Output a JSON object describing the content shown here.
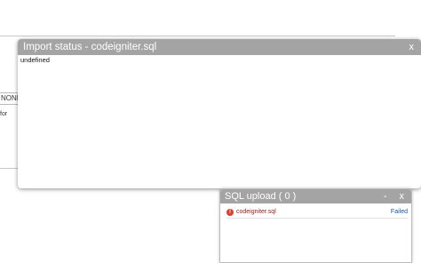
{
  "background": {
    "select_value": "NONE",
    "hint_fragment": "for"
  },
  "import_dialog": {
    "title": "Import status - codeigniter.sql",
    "close_label": "x",
    "body_text": "undefined"
  },
  "upload_panel": {
    "title": "SQL upload ( 0 )",
    "minimize_label": "-",
    "close_label": "x",
    "files": [
      {
        "name": "codeigniter.sql",
        "status": "Failed",
        "icon": "error-icon"
      }
    ]
  },
  "colors": {
    "titlebar": "#a4a4a4",
    "error": "#d8402f",
    "status_link": "#1a57a6"
  }
}
